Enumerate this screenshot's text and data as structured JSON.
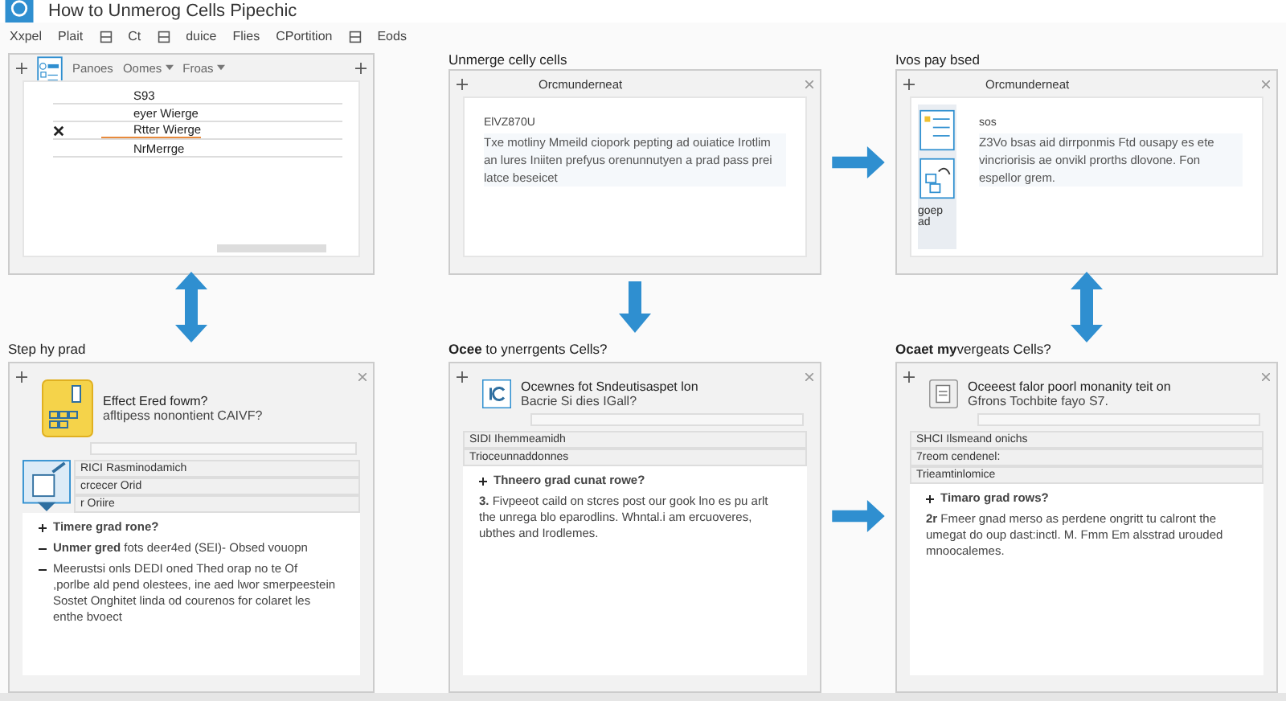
{
  "header": {
    "title": "How to Unmerog Cells Pipechic"
  },
  "menu": [
    {
      "kind": "text",
      "label": "Xxpel"
    },
    {
      "kind": "text",
      "label": "Plait"
    },
    {
      "kind": "icon"
    },
    {
      "kind": "text",
      "label": "Ct"
    },
    {
      "kind": "icon"
    },
    {
      "kind": "text",
      "label": "duice"
    },
    {
      "kind": "text",
      "label": "Flies"
    },
    {
      "kind": "text",
      "label": "CPortition"
    },
    {
      "kind": "icon"
    },
    {
      "kind": "text",
      "label": "Eods"
    }
  ],
  "top": [
    {
      "kind": "table",
      "tabs": [
        {
          "label": "Panoes",
          "dropdown": false
        },
        {
          "label": "Oomes",
          "dropdown": true
        },
        {
          "label": "Froas",
          "dropdown": true
        }
      ],
      "rows": [
        {
          "text": "S93",
          "selected": false
        },
        {
          "text": "eyer Wierge",
          "selected": false
        },
        {
          "text": "Rtter Wierge",
          "selected": true
        },
        {
          "text": "NrMerrge",
          "selected": false
        }
      ]
    },
    {
      "kind": "note",
      "heading": "Unmerge celly cells",
      "window_title": "Orcmunderneat",
      "sub": "ElVZ870U",
      "text": "Txe motliny Mmeild ciopork pepting ad ouiatice Irotlim an lures Iniiten prefyus orenunnutyen a prad pass prei latce beseicet"
    },
    {
      "kind": "note",
      "heading": "Ivos pay bsed",
      "window_title": "Orcmunderneat",
      "sub": "sos",
      "text": "Z3Vo bsas aid dirrponmis Ftd ousapy es ete vincriorisis ae onvikl prorths dlovone. Fon espellor grem.",
      "icon_label": "goep ad"
    }
  ],
  "bottom": [
    {
      "heading": "Step hy prad",
      "card_title": "Effect Ered fowm?",
      "card_sub": "afltipess nonontient CAIVF?",
      "rows": [
        "RICI Rasminodamich",
        "crcecer Orid",
        "r Oriire"
      ],
      "items": [
        {
          "kind": "plus",
          "text": "**Timere grad rone?**"
        },
        {
          "kind": "dash",
          "text": "**Unmer gred** fots deer4ed (SEI)- Obsed vouopn"
        },
        {
          "kind": "dash",
          "text": "Meerustsi onls DEDI oned Thed orap no te Of ,porlbe ald pend olestees, ine aed lwor smerpeestein Sostet Onghitet linda od courenos for colaret les enthe bvoect"
        }
      ]
    },
    {
      "heading": "**Ocee** to ynerrgents Cells?",
      "card_title": "Ocewnes fot Sndeutisaspet lon",
      "card_sub": "Bacrie Si dies IGall?",
      "rows": [
        "SIDI Ihemmeamidh",
        "Trioceunnaddonnes"
      ],
      "items": [
        {
          "kind": "plus",
          "text": "**Thneero grad cunat rowe?**"
        },
        {
          "kind": "para",
          "text": "**3.** Fivpeeot caild on stcres post our gook lno es pu arlt the unrega blo eparodlins. Whntal.i am ercuoveres, ubthes and Irodlemes."
        }
      ]
    },
    {
      "heading": "**Ocaet my**vergeats Cells?",
      "card_title": "Oceeest falor poorl monanity teit on",
      "card_sub": "Gfrons Tochbite fayo S7.",
      "rows": [
        "SHCI Ilsmeand onichs",
        "7reom cendenel:",
        "Trieamtinlomice"
      ],
      "items": [
        {
          "kind": "plus",
          "text": "**Timaro grad rows?**"
        },
        {
          "kind": "para",
          "text": "**2r** Fmeer gnad merso as perdene ongritt tu calront the umegat do oup dast:inctl. M. Fmm Em alsstrad urouded mnoocalemes."
        }
      ]
    }
  ]
}
